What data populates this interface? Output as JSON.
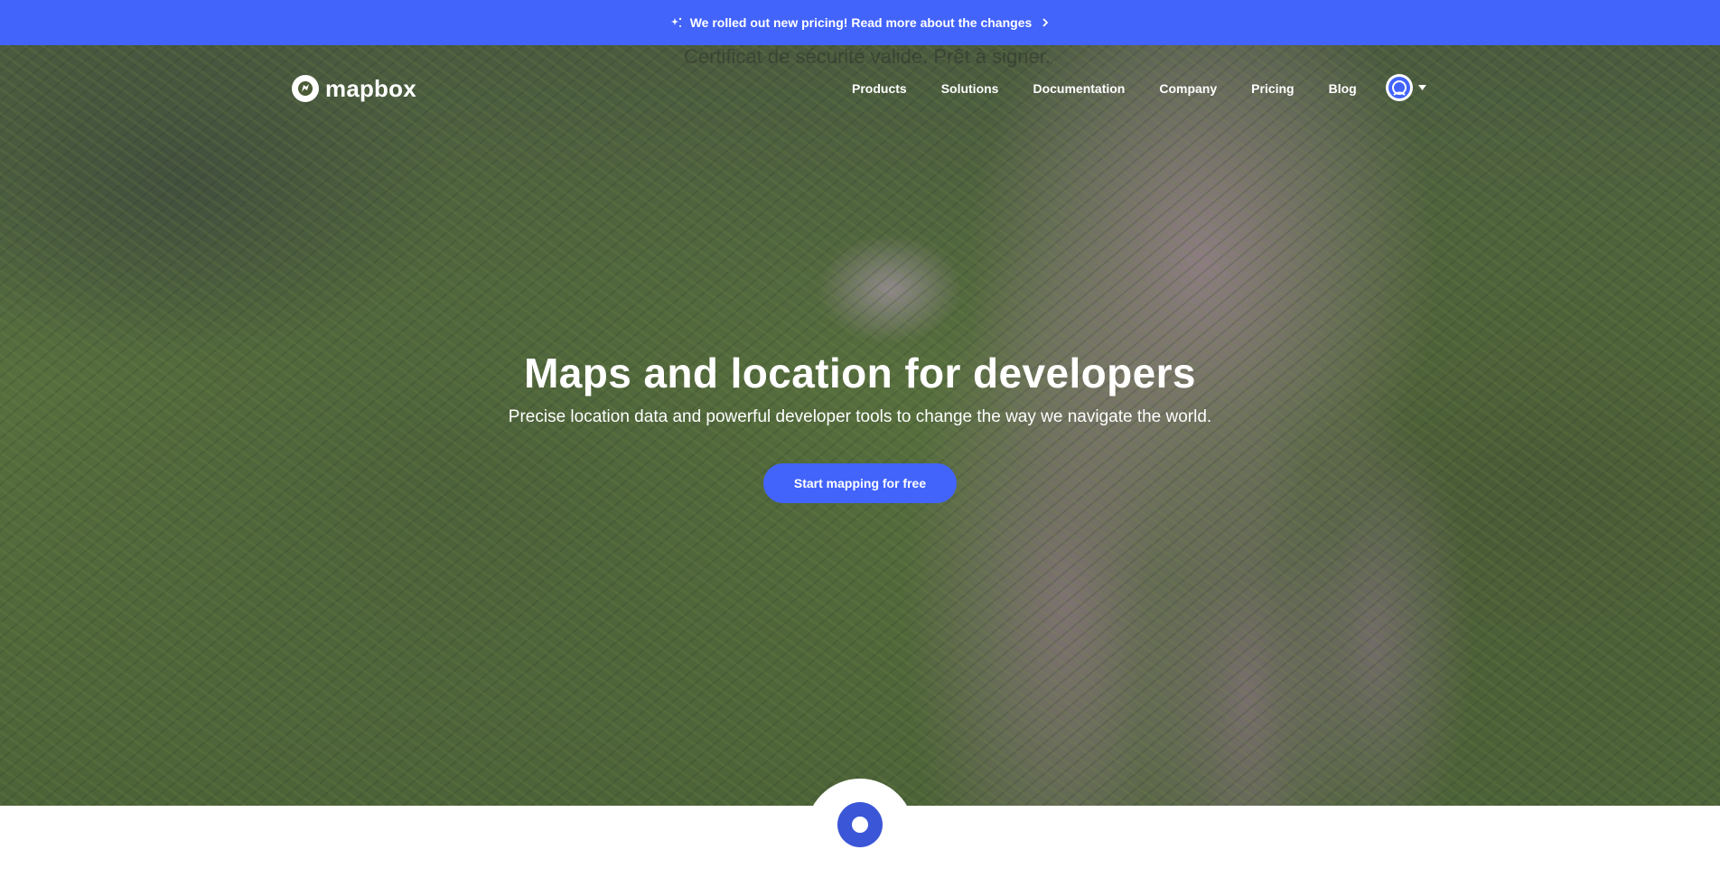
{
  "banner": {
    "text": "We rolled out new pricing! Read more about the changes",
    "spark_icon": "sparkle-icon",
    "chevron_icon": "chevron-right-icon",
    "color": "#4264fb"
  },
  "overlay_text": "Certificat de sécurité valide. Prêt à signer.",
  "nav": {
    "logo_text": "mapbox",
    "items": [
      {
        "label": "Products"
      },
      {
        "label": "Solutions"
      },
      {
        "label": "Documentation"
      },
      {
        "label": "Company"
      },
      {
        "label": "Pricing"
      },
      {
        "label": "Blog"
      }
    ],
    "avatar_icon": "user-avatar-icon",
    "caret_icon": "caret-down-icon"
  },
  "hero": {
    "title": "Maps and location for developers",
    "subtitle": "Precise location data and powerful developer tools to change the way we navigate the world.",
    "cta_label": "Start mapping for free",
    "cta_color": "#4264fb"
  },
  "bottom": {
    "icon": "location-dot-icon"
  }
}
